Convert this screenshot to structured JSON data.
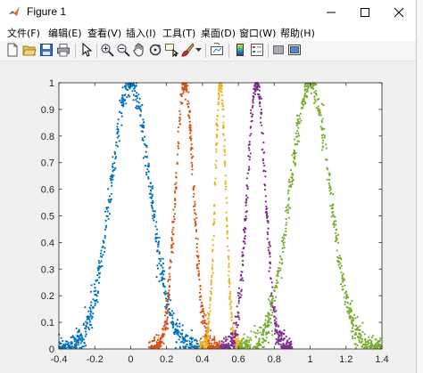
{
  "window": {
    "title": "Figure 1",
    "controls": [
      "minimize-icon",
      "maximize-icon",
      "close-icon"
    ]
  },
  "menu": {
    "items": [
      {
        "label": "文件(F)"
      },
      {
        "label": "编辑(E)"
      },
      {
        "label": "查看(V)"
      },
      {
        "label": "插入(I)"
      },
      {
        "label": "工具(T)"
      },
      {
        "label": "桌面(D)"
      },
      {
        "label": "窗口(W)"
      },
      {
        "label": "帮助(H)"
      }
    ]
  },
  "toolbar": {
    "buttons": [
      "new-figure-icon",
      "open-file-icon",
      "save-icon",
      "print-icon",
      "edit-plot-arrow-icon",
      "zoom-in-icon",
      "zoom-out-icon",
      "pan-hand-icon",
      "rotate-3d-icon",
      "data-cursor-icon",
      "brush-icon",
      "link-plot-icon",
      "insert-colorbar-icon",
      "insert-legend-icon",
      "hide-plot-tools-icon",
      "show-plot-tools-icon"
    ]
  },
  "colors": {
    "blue": "#0072BD",
    "orange": "#D95319",
    "yellow": "#EDB120",
    "purple": "#7E2F8E",
    "green": "#77AC30"
  },
  "chart_data": {
    "type": "scatter",
    "xlim": [
      -0.4,
      1.4
    ],
    "ylim": [
      0,
      1
    ],
    "x_ticks": [
      "-0.4",
      "-0.2",
      "0",
      "0.2",
      "0.4",
      "0.6",
      "0.8",
      "1",
      "1.2",
      "1.4"
    ],
    "y_ticks": [
      "0",
      "0.1",
      "0.2",
      "0.3",
      "0.4",
      "0.5",
      "0.6",
      "0.7",
      "0.8",
      "0.9",
      "1"
    ],
    "grid": false,
    "series": [
      {
        "center": 0.0,
        "width": 0.11,
        "noise": 0.045,
        "color": "#0072BD",
        "x_range": [
          -0.4,
          0.4
        ],
        "points": 700
      },
      {
        "center": 0.3,
        "width": 0.05,
        "noise": 0.045,
        "color": "#D95319",
        "x_range": [
          0.1,
          0.5
        ],
        "points": 500
      },
      {
        "center": 0.5,
        "width": 0.03,
        "noise": 0.04,
        "color": "#EDB120",
        "x_range": [
          0.38,
          0.62
        ],
        "points": 400
      },
      {
        "center": 0.7,
        "width": 0.05,
        "noise": 0.045,
        "color": "#7E2F8E",
        "x_range": [
          0.5,
          0.9
        ],
        "points": 500
      },
      {
        "center": 1.0,
        "width": 0.11,
        "noise": 0.045,
        "color": "#77AC30",
        "x_range": [
          0.6,
          1.4
        ],
        "points": 700
      }
    ]
  }
}
